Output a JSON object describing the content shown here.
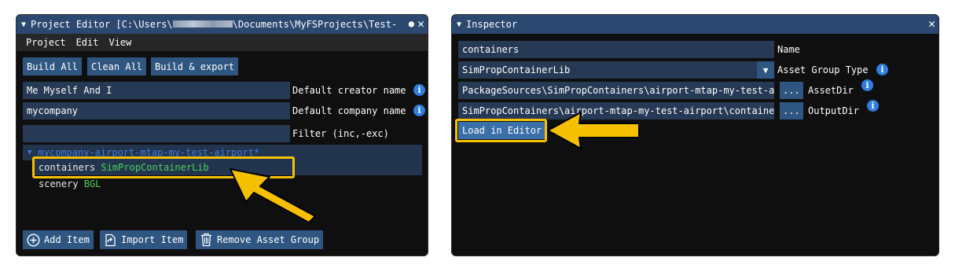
{
  "project_editor": {
    "title": "Project Editor [C:\\Users\\",
    "title_suffix": "\\Documents\\MyFSProjects\\Test-",
    "menu": [
      "Project",
      "Edit",
      "View"
    ],
    "buttons": {
      "build_all": "Build All",
      "clean_all": "Clean All",
      "build_export": "Build & export"
    },
    "creator_value": "Me Myself And I",
    "creator_label": "Default creator name",
    "company_value": "mycompany",
    "company_label": "Default company name",
    "filter_value": "",
    "filter_label": "Filter (inc,-exc)",
    "tree": {
      "package": "mycompany-airport-mtap-my-test-airport*",
      "items": [
        {
          "name": "containers",
          "type": "SimPropContainerLib"
        },
        {
          "name": "scenery",
          "type": "BGL"
        }
      ]
    },
    "footer": {
      "add_item": "Add Item",
      "import_item": "Import Item",
      "remove_group": "Remove Asset Group"
    }
  },
  "inspector": {
    "title": "Inspector",
    "name_value": "containers",
    "name_label": "Name",
    "group_type_value": "SimPropContainerLib",
    "group_type_label": "Asset Group Type",
    "asset_dir_value": "PackageSources\\SimPropContainers\\airport-mtap-my-test-a",
    "asset_dir_label": "AssetDir",
    "output_dir_value": "SimPropContainers\\airport-mtap-my-test-airport\\containe",
    "output_dir_label": "OutputDir",
    "browse_label": "...",
    "load_button": "Load in Editor"
  },
  "colors": {
    "highlight": "#f5c000",
    "info": "#2f7fe0",
    "button": "#2f5680",
    "field": "#263a56",
    "tree_text": "#3c7ee0",
    "type_text": "#4ad15a"
  }
}
